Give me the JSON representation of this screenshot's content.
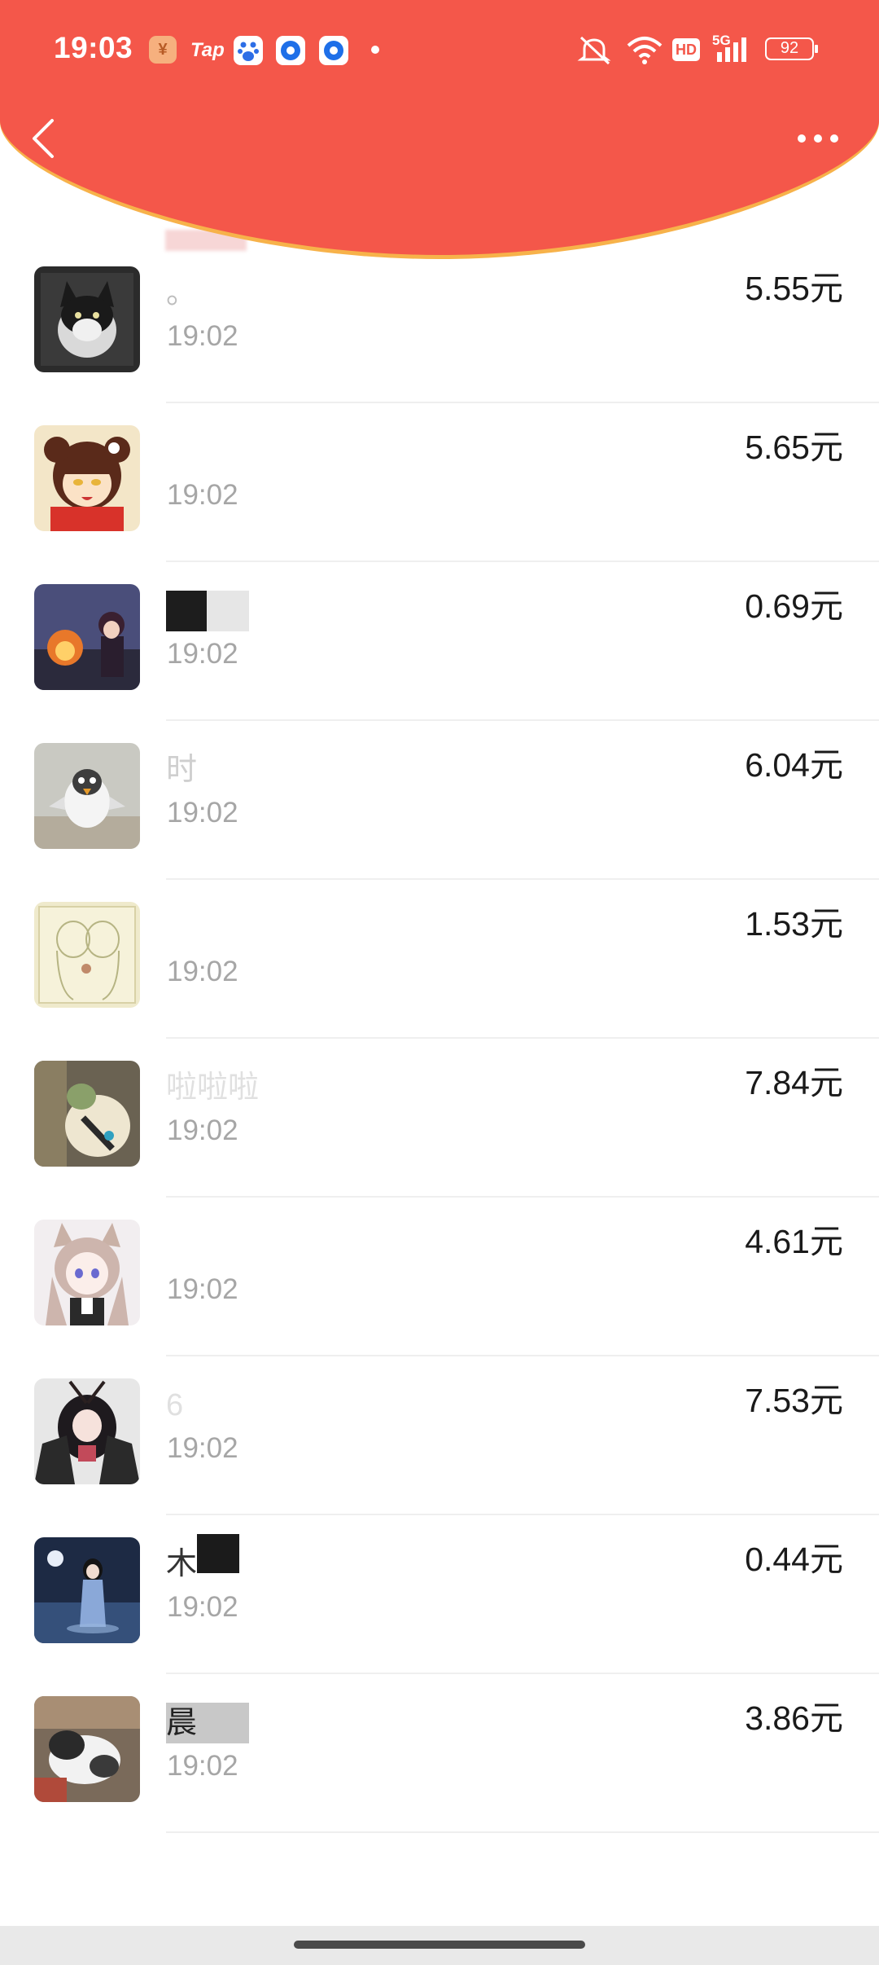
{
  "status_bar": {
    "time": "19:03",
    "app_icons": [
      "yuan-app-icon",
      "tap-app-icon",
      "baidu-app-icon",
      "blue-circle-app-icon",
      "blue-circle-app-icon"
    ],
    "tap_label": "Tap",
    "yuan_label": "¥",
    "network": "5G",
    "hd_label": "HD",
    "battery": "92"
  },
  "header": {
    "color": "#f4574a",
    "curve_edge": "#f7b24a"
  },
  "entries": [
    {
      "name": "。",
      "time": "19:02",
      "amount": "5.55元"
    },
    {
      "name": "",
      "time": "19:02",
      "amount": "5.65元"
    },
    {
      "name": "",
      "time": "19:02",
      "amount": "0.69元"
    },
    {
      "name": "时",
      "time": "19:02",
      "amount": "6.04元"
    },
    {
      "name": "",
      "time": "19:02",
      "amount": "1.53元"
    },
    {
      "name": "啦啦啦",
      "time": "19:02",
      "amount": "7.84元"
    },
    {
      "name": "",
      "time": "19:02",
      "amount": "4.61元"
    },
    {
      "name": "6",
      "time": "19:02",
      "amount": "7.53元"
    },
    {
      "name": "木",
      "time": "19:02",
      "amount": "0.44元"
    },
    {
      "name": "晨",
      "time": "19:02",
      "amount": "3.86元"
    }
  ]
}
